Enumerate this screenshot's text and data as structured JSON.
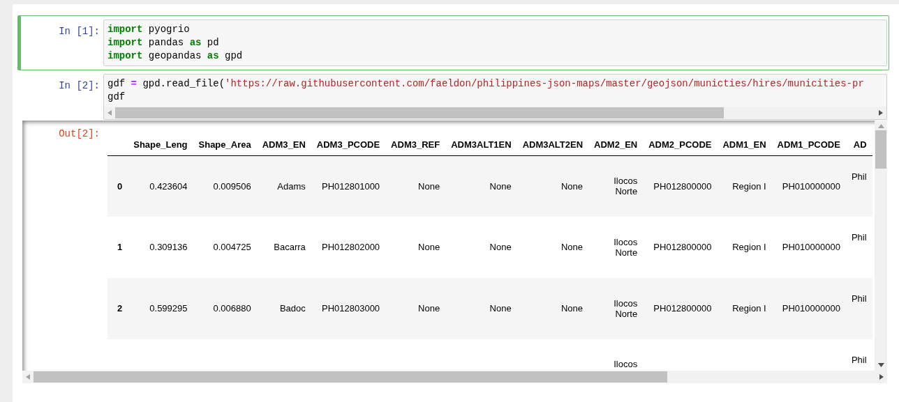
{
  "cells": [
    {
      "prompt": "In [1]:",
      "selected": true,
      "lines": [
        [
          {
            "kind": "keyword",
            "text": "import"
          },
          {
            "kind": "plain",
            "text": " pyogrio"
          }
        ],
        [
          {
            "kind": "keyword",
            "text": "import"
          },
          {
            "kind": "plain",
            "text": " pandas "
          },
          {
            "kind": "keyword",
            "text": "as"
          },
          {
            "kind": "plain",
            "text": " pd"
          }
        ],
        [
          {
            "kind": "keyword",
            "text": "import"
          },
          {
            "kind": "plain",
            "text": " geopandas "
          },
          {
            "kind": "keyword",
            "text": "as"
          },
          {
            "kind": "plain",
            "text": " gpd"
          }
        ]
      ]
    },
    {
      "prompt": "In [2]:",
      "selected": false,
      "lines": [
        [
          {
            "kind": "plain",
            "text": "gdf "
          },
          {
            "kind": "operator",
            "text": "="
          },
          {
            "kind": "plain",
            "text": " gpd.read_file("
          },
          {
            "kind": "string",
            "text": "'https://raw.githubusercontent.com/faeldon/philippines-json-maps/master/geojson/municties/hires/municities-pr"
          }
        ],
        [
          {
            "kind": "plain",
            "text": "gdf"
          }
        ]
      ],
      "output": {
        "prompt": "Out[2]:",
        "table": {
          "columns": [
            "",
            "Shape_Leng",
            "Shape_Area",
            "ADM3_EN",
            "ADM3_PCODE",
            "ADM3_REF",
            "ADM3ALT1EN",
            "ADM3ALT2EN",
            "ADM2_EN",
            "ADM2_PCODE",
            "ADM1_EN",
            "ADM1_PCODE",
            "AD"
          ],
          "rows": [
            [
              "0",
              "0.423604",
              "0.009506",
              "Adams",
              "PH012801000",
              "None",
              "None",
              "None",
              "Ilocos Norte",
              "PH012800000",
              "Region I",
              "PH010000000",
              "Phil"
            ],
            [
              "1",
              "0.309136",
              "0.004725",
              "Bacarra",
              "PH012802000",
              "None",
              "None",
              "None",
              "Ilocos Norte",
              "PH012800000",
              "Region I",
              "PH010000000",
              "Phil"
            ],
            [
              "2",
              "0.599295",
              "0.006880",
              "Badoc",
              "PH012803000",
              "None",
              "None",
              "None",
              "Ilocos Norte",
              "PH012800000",
              "Region I",
              "PH010000000",
              "Phil"
            ],
            [
              null,
              null,
              null,
              null,
              null,
              null,
              null,
              null,
              "Ilocos",
              null,
              null,
              null,
              "Phil"
            ]
          ]
        }
      }
    }
  ]
}
